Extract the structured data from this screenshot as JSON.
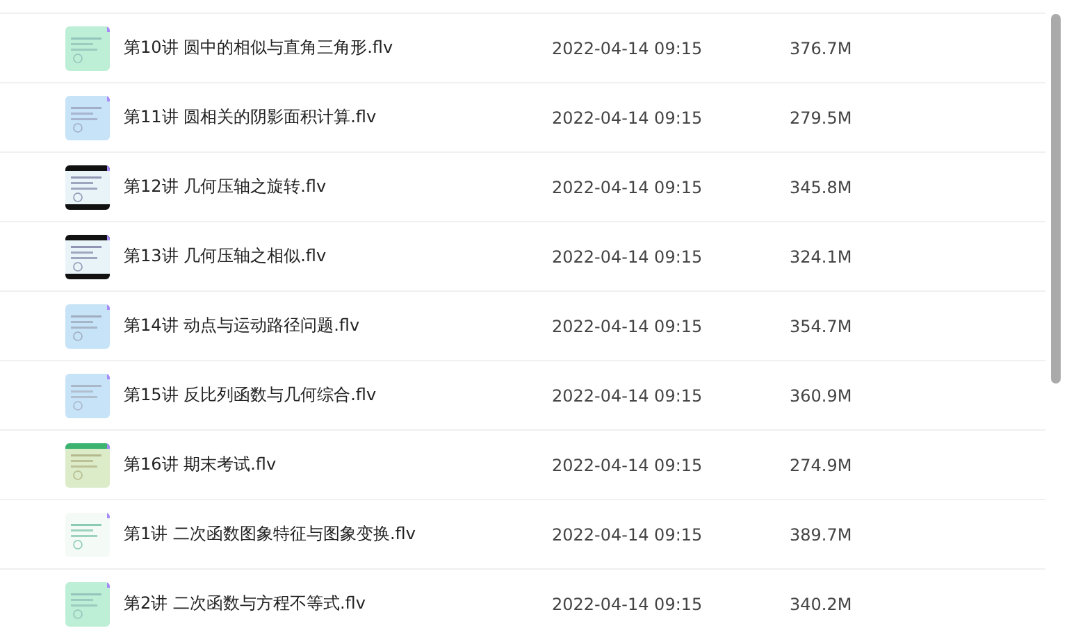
{
  "files": [
    {
      "name": "第10讲 圆中的相似与直角三角形.flv",
      "date": "2022-04-14 09:15",
      "size": "376.7M"
    },
    {
      "name": "第11讲 圆相关的阴影面积计算.flv",
      "date": "2022-04-14 09:15",
      "size": "279.5M"
    },
    {
      "name": "第12讲 几何压轴之旋转.flv",
      "date": "2022-04-14 09:15",
      "size": "345.8M"
    },
    {
      "name": "第13讲 几何压轴之相似.flv",
      "date": "2022-04-14 09:15",
      "size": "324.1M"
    },
    {
      "name": "第14讲 动点与运动路径问题.flv",
      "date": "2022-04-14 09:15",
      "size": "354.7M"
    },
    {
      "name": "第15讲 反比列函数与几何综合.flv",
      "date": "2022-04-14 09:15",
      "size": "360.9M"
    },
    {
      "name": "第16讲 期末考试.flv",
      "date": "2022-04-14 09:15",
      "size": "274.9M"
    },
    {
      "name": "第1讲 二次函数图象特征与图象变换.flv",
      "date": "2022-04-14 09:15",
      "size": "389.7M"
    },
    {
      "name": "第2讲 二次函数与方程不等式.flv",
      "date": "2022-04-14 09:15",
      "size": "340.2M"
    }
  ]
}
